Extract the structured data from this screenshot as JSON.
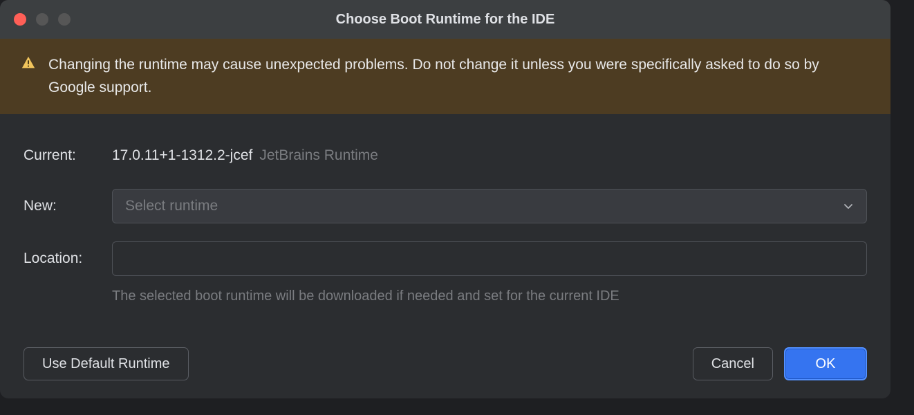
{
  "dialog": {
    "title": "Choose Boot Runtime for the IDE",
    "warning": "Changing the runtime may cause unexpected problems. Do not change it unless you were specifically asked to do so by Google support.",
    "labels": {
      "current": "Current:",
      "new": "New:",
      "location": "Location:"
    },
    "current": {
      "version": "17.0.11+1-1312.2-jcef",
      "vendor": "JetBrains Runtime"
    },
    "new": {
      "placeholder": "Select runtime"
    },
    "location": {
      "value": ""
    },
    "helper": "The selected boot runtime will be downloaded if needed and set for the current IDE",
    "buttons": {
      "useDefault": "Use Default Runtime",
      "cancel": "Cancel",
      "ok": "OK"
    }
  }
}
